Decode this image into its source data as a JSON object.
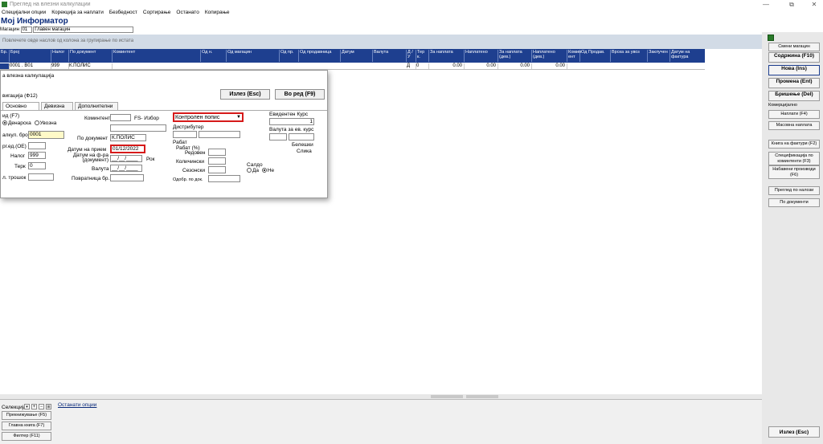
{
  "window": {
    "title": "Преглед на влезни калкулации",
    "minimize": "—",
    "restore": "⧉",
    "close": "✕"
  },
  "menu": [
    "Специјални опции",
    "Корекција за наплати",
    "Безбедност",
    "Сортирање",
    "Останато",
    "Копирање"
  ],
  "app_title": "Мој Информатор",
  "store": {
    "label": "Магацин",
    "code": "01",
    "name": "Главен магацин"
  },
  "group_hint": "Повлечете овде наслов од колона за групирање по истата",
  "grid": {
    "headers": [
      "Бр.",
      "Број",
      "Налог",
      "По документ",
      "Коминтент",
      "Од н.",
      "Од магацин",
      "Од пр.",
      "Од продавница",
      "Датум",
      "Валута",
      "Д / У",
      "Тер к.",
      "За наплата",
      "Наплатено",
      "За наплата (дев.)",
      "Наплатено (дев.)",
      "Комин ент",
      "Од Продав.",
      "Врска за увоз",
      "Заклучен",
      "Датум на фактура"
    ],
    "row": {
      "num": "0001 . В01",
      "nalog": "999",
      "dokument": "К.ПОЛИС",
      "du": "Д",
      "ter": "0",
      "za_naplata": "0.00",
      "naplateno": "0.00",
      "za_naplata_dev": "0.00",
      "naplateno_dev": "0.00"
    }
  },
  "dialog": {
    "title": "а влезна калкулација",
    "nav_label": "вигација (Ф12)",
    "exit_btn": "Излез (Esc)",
    "order_btn": "Во ред (F9)",
    "tabs": [
      "Основно",
      "Девизна",
      "Дополнителни"
    ],
    "left": {
      "vid_label": "ид (F7)",
      "radio_denarska": "Денарска",
      "radio_uvozna": "Увозна",
      "kalk_broj_label": "алкул. број",
      "kalk_broj_value": "0001",
      "org_label": "рг.ед.(ОЕ)",
      "nalog_label": "Налог",
      "nalog_value": "999",
      "ter_label": "Терк",
      "ter_value": "0",
      "trosok_label": "л. трошок"
    },
    "middle": {
      "komitent_label": "Коминтент",
      "fs_label": "FS- Избор",
      "po_dokument_label": "По документ",
      "po_dokument_value": "К.ПОЛИС",
      "datum_priem_label": "Датум на прием",
      "datum_priem_value": "01/12/2022",
      "datum_fra_label": "Датум на ф-ра (документ)",
      "datum_fra_value": "__/__/____",
      "rok_label": "Рок",
      "valuta_label": "Валута",
      "valuta_value": "__/__/____",
      "povratnica_label": "Повратница бр."
    },
    "right": {
      "type_value": "Контролен попис",
      "distributer_label": "Дистрибутер",
      "rabat_label": "Рабат",
      "rabat_pct_label": "Рабат (%)",
      "redoven_label": "Редовен",
      "kolicinski_label": "Количински",
      "sezonski_label": "Сезонски",
      "odobr_label": "Одобр. по док.",
      "evid_kurs_label": "Евидентен Курс",
      "evid_kurs_value": "1",
      "valuta_ev_kurs_label": "Валута за ев. курс",
      "beleski_label": "Белешки",
      "slika_label": "Слика",
      "saldo_label": "Салдо",
      "saldo_da": "Да",
      "saldo_ne": "Не"
    }
  },
  "sidebar": {
    "buttons": [
      {
        "label": "Смени магацин",
        "bold": false
      },
      {
        "label": "Содржина (F10)",
        "bold": true
      },
      {
        "label": "Нова (Ins)",
        "bold": true
      },
      {
        "label": "Промена (Ent)",
        "bold": true
      },
      {
        "label": "Бришење (Del)",
        "bold": true
      }
    ],
    "section_label": "Комерцијално",
    "buttons2": [
      "Наплати (F4)",
      "Масовна наплата",
      "Книга на фактури (F2)",
      "Спецификација по коминтенти (F3)",
      "Набавени производи (F6)",
      "Преглед по налози",
      "По документи"
    ],
    "exit": "Излез (Esc)"
  },
  "bottom": {
    "selection_label": "Селекција",
    "other_options": "Останати опции",
    "buttons": [
      "Прекнижување (F5)",
      "Главна книга (F7)",
      "Филтер (F11)"
    ]
  }
}
